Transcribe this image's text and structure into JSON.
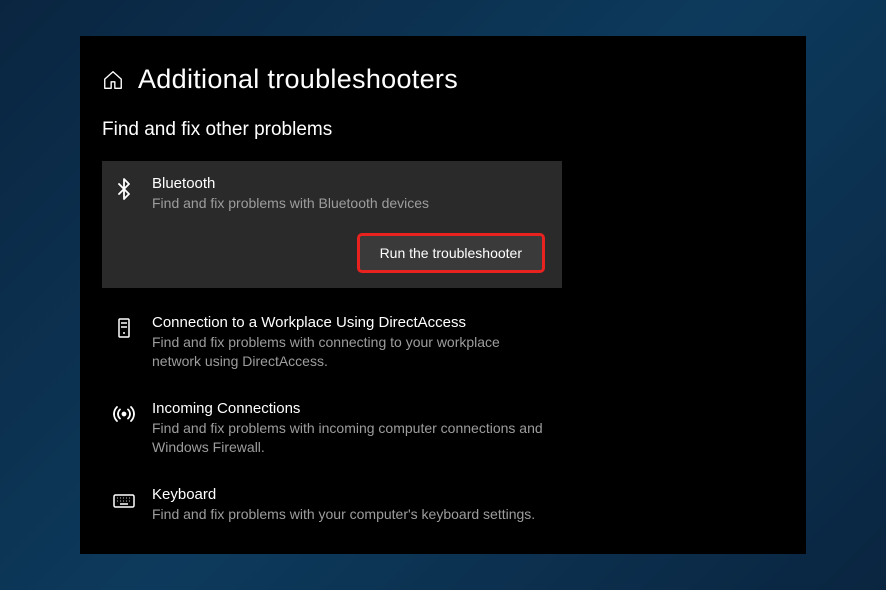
{
  "header": {
    "title": "Additional troubleshooters"
  },
  "section": {
    "title": "Find and fix other problems"
  },
  "items": [
    {
      "title": "Bluetooth",
      "desc": "Find and fix problems with Bluetooth devices",
      "button": "Run the troubleshooter"
    },
    {
      "title": "Connection to a Workplace Using DirectAccess",
      "desc": "Find and fix problems with connecting to your workplace network using DirectAccess."
    },
    {
      "title": "Incoming Connections",
      "desc": "Find and fix problems with incoming computer connections and Windows Firewall."
    },
    {
      "title": "Keyboard",
      "desc": "Find and fix problems with your computer's keyboard settings."
    }
  ]
}
